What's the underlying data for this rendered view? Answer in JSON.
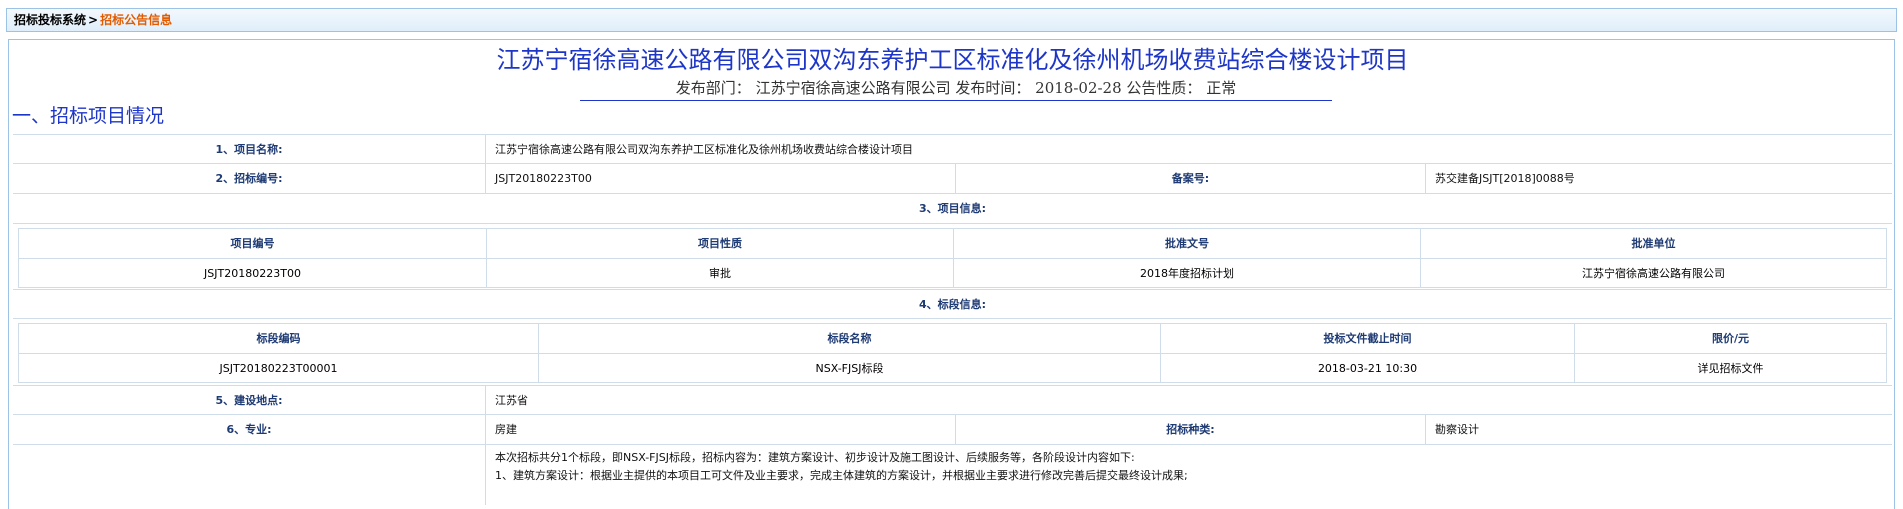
{
  "breadcrumb": {
    "root": "招标投标系统",
    "separator": ">",
    "current": "招标公告信息"
  },
  "header": {
    "title": "江苏宁宿徐高速公路有限公司双沟东养护工区标准化及徐州机场收费站综合楼设计项目",
    "dept_label": "发布部门：",
    "dept": "江苏宁宿徐高速公路有限公司",
    "time_label": "发布时间：",
    "time": "2018-02-28",
    "nature_label": "公告性质：",
    "nature": "正常"
  },
  "section1": {
    "title": "一、招标项目情况"
  },
  "fields": {
    "project_name_label": "1、项目名称:",
    "project_name": "江苏宁宿徐高速公路有限公司双沟东养护工区标准化及徐州机场收费站综合楼设计项目",
    "bid_no_label": "2、招标编号:",
    "bid_no": "JSJT20180223T00",
    "record_no_label": "备案号:",
    "record_no": "苏交建备JSJT[2018]0088号",
    "project_info_label": "3、项目信息:",
    "section_info_label": "4、标段信息:",
    "location_label": "5、建设地点:",
    "location": "江苏省",
    "specialty_label": "6、专业:",
    "specialty": "房建",
    "bid_type_label": "招标种类:",
    "bid_type": "勘察设计",
    "desc_line1": "本次招标共分1个标段，即NSX-FJSJ标段，招标内容为：建筑方案设计、初步设计及施工图设计、后续服务等，各阶段设计内容如下:",
    "desc_line2": "1、建筑方案设计：根据业主提供的本项目工可文件及业主要求，完成主体建筑的方案设计，并根据业主要求进行修改完善后提交最终设计成果;"
  },
  "project_table": {
    "headers": [
      "项目编号",
      "项目性质",
      "批准文号",
      "批准单位"
    ],
    "row": [
      "JSJT20180223T00",
      "审批",
      "2018年度招标计划",
      "江苏宁宿徐高速公路有限公司"
    ]
  },
  "section_table": {
    "headers": [
      "标段编码",
      "标段名称",
      "投标文件截止时间",
      "限价/元"
    ],
    "row": [
      "JSJT20180223T00001",
      "NSX-FJSJ标段",
      "2018-03-21 10:30",
      "详见招标文件"
    ]
  }
}
